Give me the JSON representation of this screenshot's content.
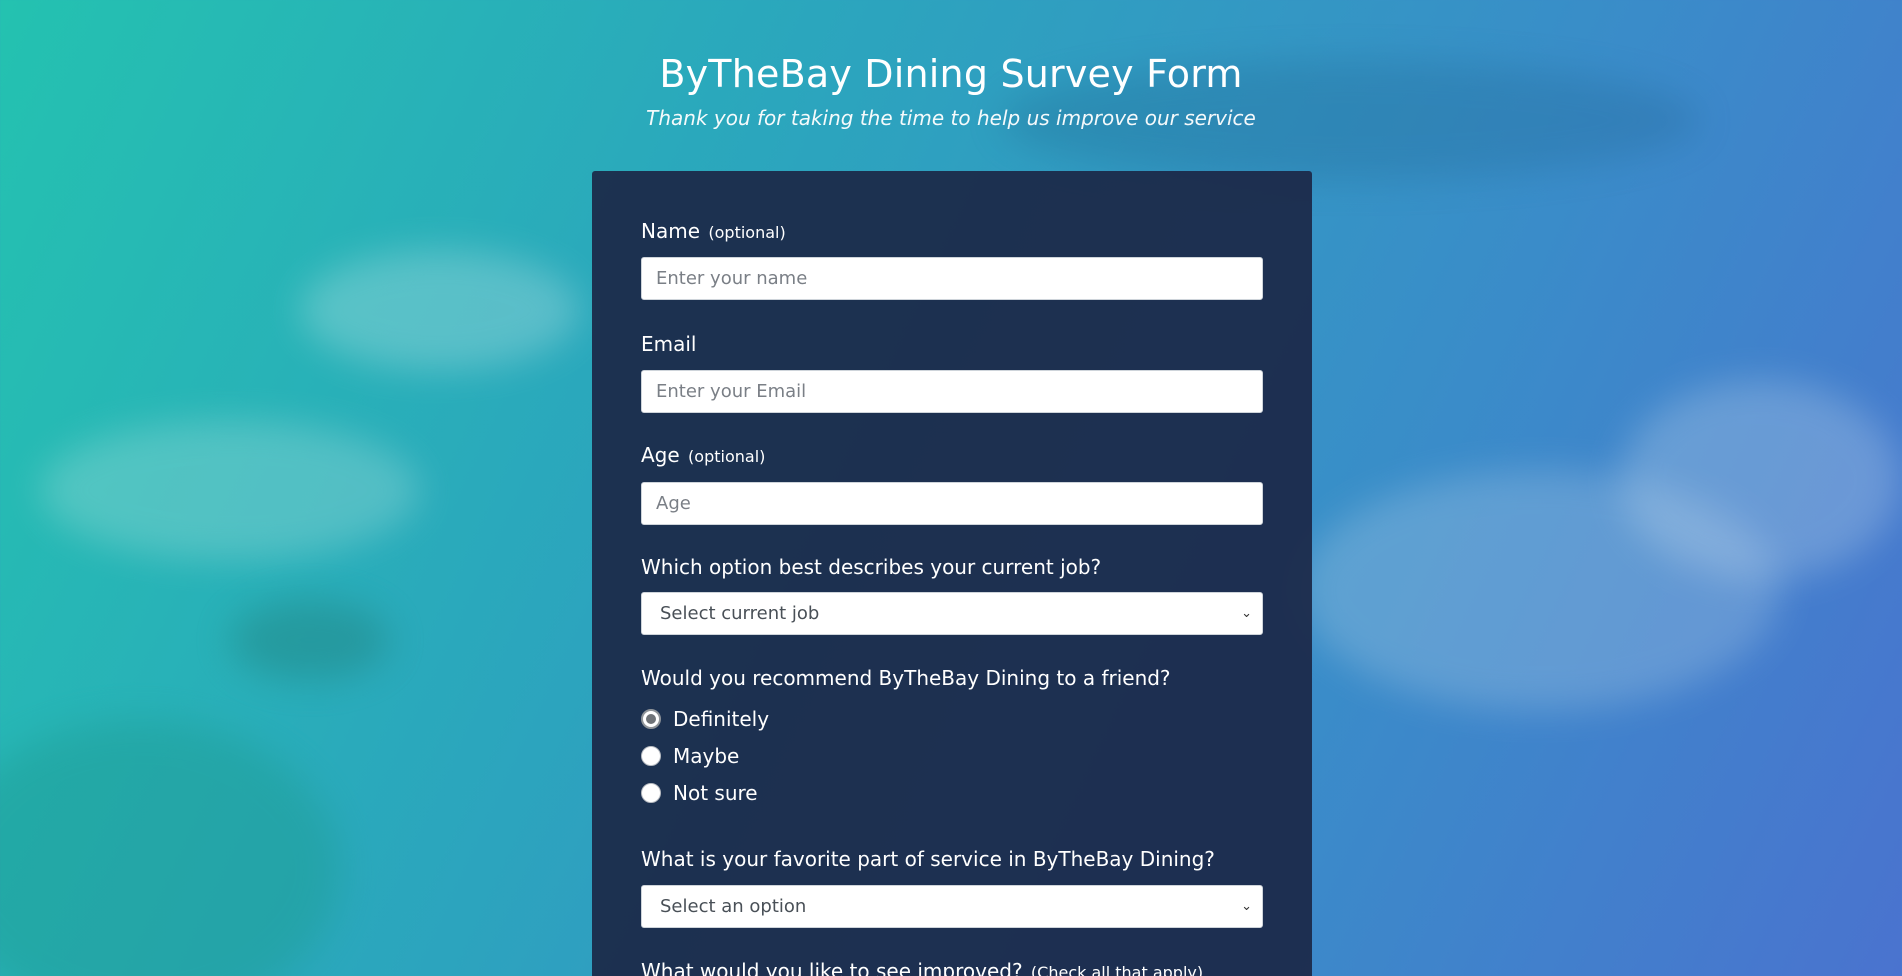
{
  "header": {
    "title": "ByTheBay Dining Survey Form",
    "subtitle": "Thank you for taking the time to help us improve our service"
  },
  "form": {
    "name": {
      "label": "Name",
      "note": "(optional)",
      "placeholder": "Enter your name",
      "value": ""
    },
    "email": {
      "label": "Email",
      "placeholder": "Enter your Email",
      "value": ""
    },
    "age": {
      "label": "Age",
      "note": "(optional)",
      "placeholder": "Age",
      "value": ""
    },
    "job": {
      "label": "Which option best describes your current job?",
      "selected": "Select current job"
    },
    "recommend": {
      "label": "Would you recommend ByTheBay Dining to a friend?",
      "options": [
        "Definitely",
        "Maybe",
        "Not sure"
      ],
      "selected_index": 0
    },
    "favorite": {
      "label": "What is your favorite part of service in ByTheBay Dining?",
      "selected": "Select an option"
    },
    "improved": {
      "label": "What would you like to see improved?",
      "note": "(Check all that apply)"
    }
  },
  "icons": {
    "select_chevron": "chevron-down-icon"
  },
  "colors": {
    "gradient_start": "#24c2b0",
    "gradient_end": "#4a73cf",
    "card_background": "#1b2746"
  }
}
